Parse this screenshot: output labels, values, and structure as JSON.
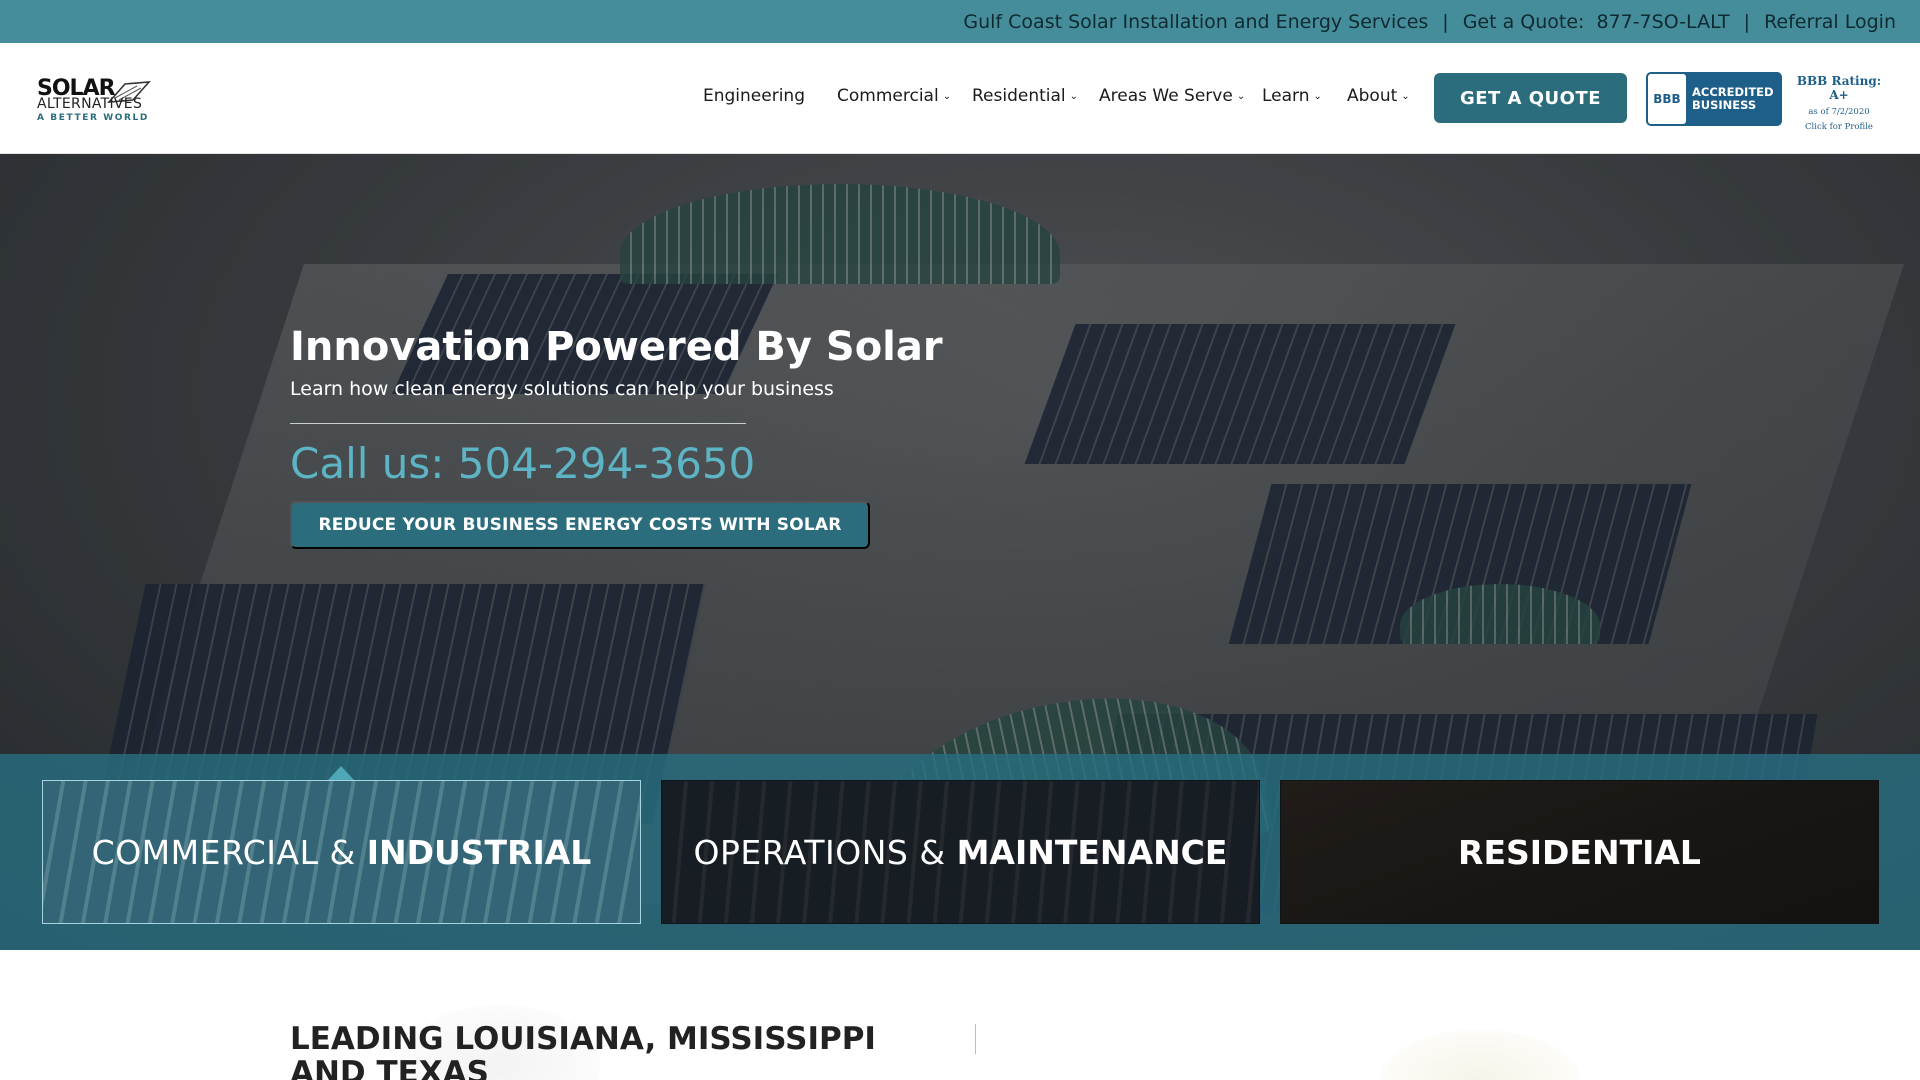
{
  "topbar": {
    "tagline": "Gulf Coast Solar Installation and Energy Services",
    "separator1": "|",
    "quote_label": "Get a Quote:",
    "quote_phone": "877-7SO-LALT",
    "separator2": "|",
    "referral_login": "Referral Login",
    "background_color": "#468d9b"
  },
  "logo": {
    "line1": "SOLAR",
    "line2": "ALTERNATIVES",
    "line3": "A BETTER WORLD"
  },
  "nav": {
    "items": [
      {
        "label": "Engineering",
        "has_dropdown": false
      },
      {
        "label": "Commercial",
        "has_dropdown": true
      },
      {
        "label": "Residential",
        "has_dropdown": true
      },
      {
        "label": "Areas We Serve",
        "has_dropdown": true
      },
      {
        "label": "Learn",
        "has_dropdown": true
      },
      {
        "label": "About",
        "has_dropdown": true
      }
    ],
    "dropdown_icon": "chevron-down-icon",
    "quote_button": "GET A QUOTE",
    "accent_color": "#2c6d7d"
  },
  "bbb": {
    "seal_logo": "BBB",
    "seal_line1": "ACCREDITED",
    "seal_line2": "BUSINESS",
    "rating": "BBB Rating: A+",
    "as_of": "as of 7/2/2020",
    "profile_link": "Click for Profile"
  },
  "hero": {
    "title": "Innovation Powered By Solar",
    "subtitle": "Learn how clean energy solutions can help your business",
    "call": "Call us: 504-294-3650",
    "cta": "REDUCE YOUR BUSINESS ENERGY COSTS WITH SOLAR",
    "call_color": "#5cb4c4"
  },
  "services": [
    {
      "thin": "COMMERCIAL & ",
      "bold": "INDUSTRIAL",
      "active": true
    },
    {
      "thin": "OPERATIONS & ",
      "bold": "MAINTENANCE",
      "active": false
    },
    {
      "thin": "",
      "bold": "RESIDENTIAL",
      "active": false
    }
  ],
  "lower": {
    "heading": "LEADING LOUISIANA, MISSISSIPPI AND TEXAS"
  }
}
